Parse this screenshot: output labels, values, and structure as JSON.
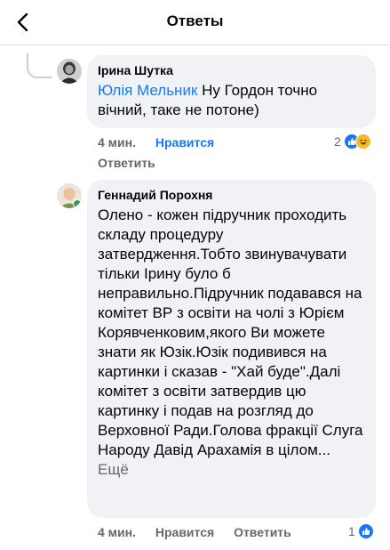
{
  "header": {
    "title": "Ответы"
  },
  "comments": [
    {
      "author": "Ірина Шутка",
      "mention": "Юлія Мельник",
      "text": " Ну Гордон точно вічний, таке не потоне)",
      "time": "4 мин.",
      "like_label": "Нравится",
      "reply_label": "Ответить",
      "reaction_count": "2",
      "reactions": [
        "like-icon",
        "haha-icon"
      ]
    },
    {
      "author": "Геннадий Порохня",
      "text": "Олено - кожен підручник проходить складу процедуру затвердження.Тобто звинувачувати тільки Ірину було б неправильно.Підручник подавався на комітет ВР з освіти на чолі з Юрієм Корявченковим,якого Ви можете знати як Юзік.Юзік подивився на картинки і сказав - \"Хай буде\".Далі комітет з освіти затвердив цю картинку і подав на розгляд до Верховної Ради.Голова фракції Слуга Народу Давід Арахамія в цілом...",
      "more_label": "Ещё",
      "time": "4 мин.",
      "like_label": "Нравится",
      "reply_label": "Ответить",
      "reaction_count": "1",
      "reactions": [
        "like-icon"
      ]
    }
  ],
  "colors": {
    "accent": "#1877f2",
    "secondary_text": "#65676b",
    "bubble": "#f0f2f5"
  }
}
